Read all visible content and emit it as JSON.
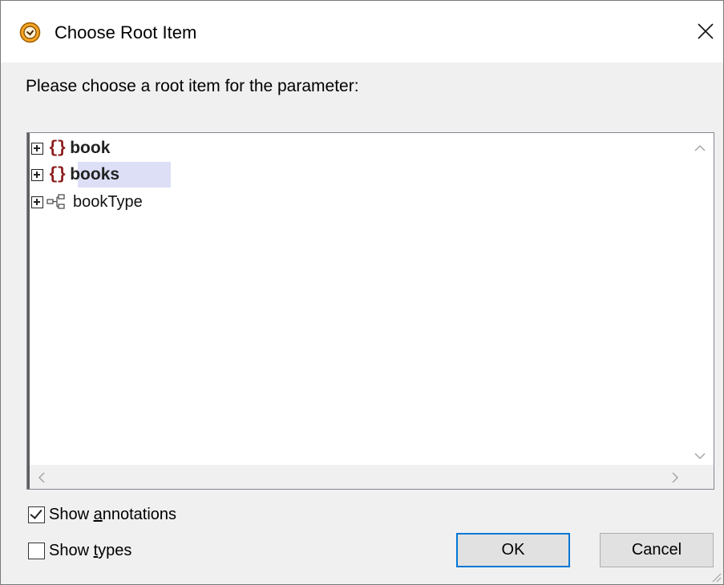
{
  "window": {
    "title": "Choose Root Item",
    "app_icon": "clock-app-icon",
    "close_icon": "close-icon"
  },
  "prompt": "Please choose a root item for the parameter:",
  "tree": {
    "items": [
      {
        "label": "book",
        "kind": "element",
        "icon": "element-braces-icon",
        "selected": false
      },
      {
        "label": "books",
        "kind": "element",
        "icon": "element-braces-icon",
        "selected": true
      },
      {
        "label": "bookType",
        "kind": "complex-type",
        "icon": "complex-type-icon",
        "selected": false
      }
    ],
    "element_icon_text": "{}"
  },
  "options": {
    "show_annotations": {
      "prefix": "Show ",
      "accel": "a",
      "suffix": "nnotations",
      "checked": true
    },
    "show_types": {
      "prefix": "Show ",
      "accel": "t",
      "suffix": "ypes",
      "checked": false
    }
  },
  "buttons": {
    "ok": "OK",
    "cancel": "Cancel"
  },
  "colors": {
    "element_icon": "#8b1a1a",
    "selection": "#dcdff6",
    "default_button_border": "#0078d7",
    "app_icon": "#f5a623"
  }
}
